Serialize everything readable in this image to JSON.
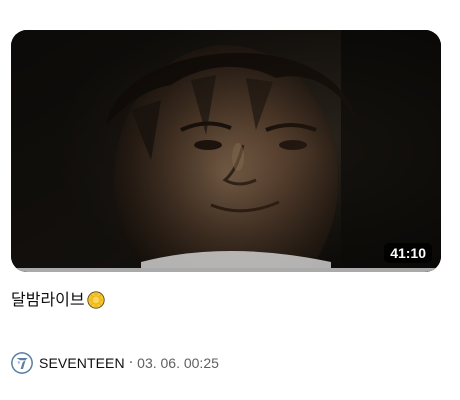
{
  "video": {
    "title": "달밤라이브",
    "duration": "41:10",
    "progress_fraction": 1.0,
    "title_emoji": "sun-emoji-icon"
  },
  "channel": {
    "name": "SEVENTEEN",
    "separator": "·",
    "published": "03. 06. 00:25",
    "avatar_icon": "seventeen-logo-icon",
    "avatar_color": "#5b7fa3"
  },
  "colors": {
    "progress": "#aaaaaa",
    "duration_bg": "#000000",
    "emoji_fill": "#f7c52b"
  }
}
